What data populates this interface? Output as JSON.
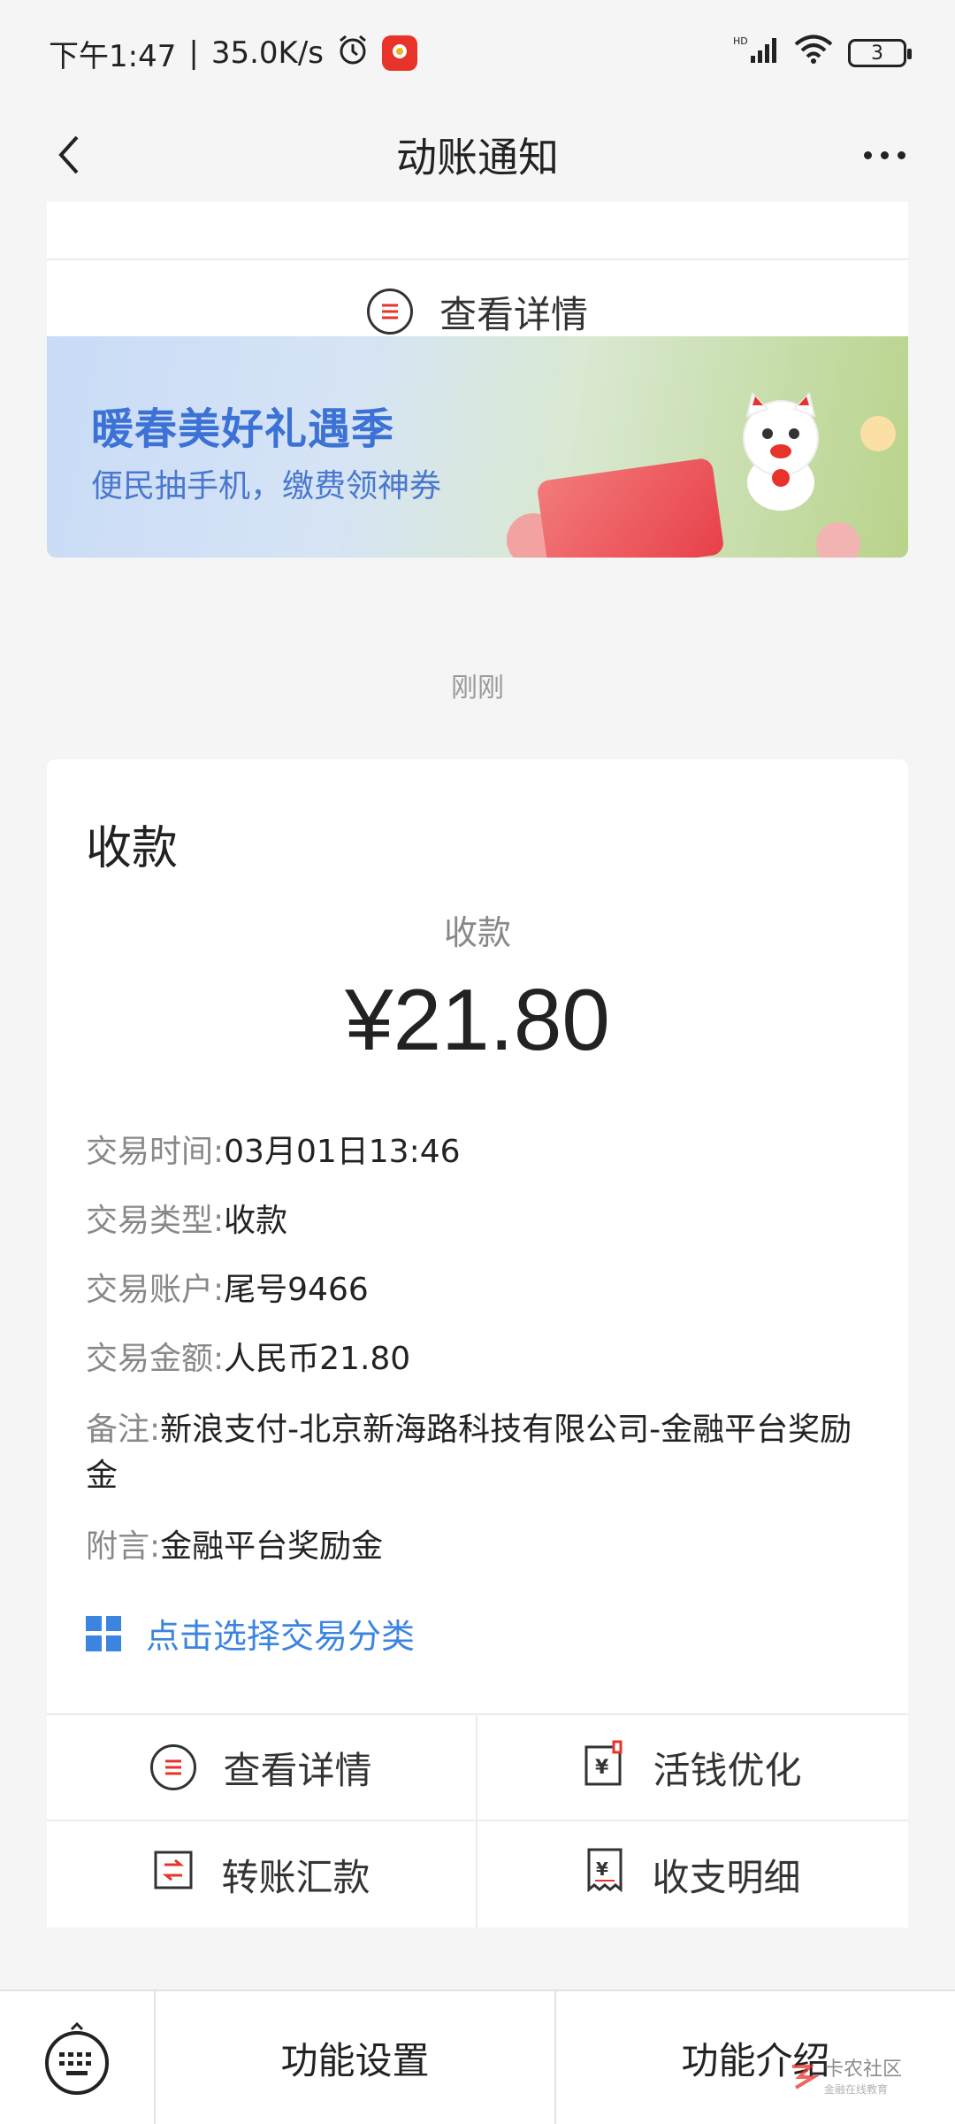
{
  "status_bar": {
    "time": "下午1:47",
    "net_speed": "35.0K/s",
    "battery": "3"
  },
  "navbar": {
    "title": "动账通知"
  },
  "prev_card": {
    "detail_label": "查看详情"
  },
  "banner": {
    "title": "暖春美好礼遇季",
    "subtitle": "便民抽手机，缴费领神券"
  },
  "timestamp": "刚刚",
  "message": {
    "title": "收款",
    "subtitle": "收款",
    "amount": "¥21.80",
    "rows": [
      {
        "label": "交易时间:",
        "value": "03月01日13:46"
      },
      {
        "label": "交易类型:",
        "value": "收款"
      },
      {
        "label": "交易账户:",
        "value": "尾号9466"
      },
      {
        "label": "交易金额:",
        "value": "人民币21.80"
      },
      {
        "label": "备注:",
        "value": "新浪支付-北京新海路科技有限公司-金融平台奖励金"
      },
      {
        "label": "附言:",
        "value": "金融平台奖励金"
      }
    ],
    "classify_label": "点击选择交易分类",
    "actions": [
      {
        "label": "查看详情",
        "icon": "list-icon"
      },
      {
        "label": "活钱优化",
        "icon": "yuan-doc-icon"
      },
      {
        "label": "转账汇款",
        "icon": "transfer-icon"
      },
      {
        "label": "收支明细",
        "icon": "receipt-icon"
      }
    ]
  },
  "bottom_bar": {
    "settings_label": "功能设置",
    "intro_label": "功能介绍"
  },
  "watermark": {
    "line1": "卡农社区",
    "line2": "金融在线教育"
  },
  "colors": {
    "accent_blue": "#3b84e0",
    "banner_title": "#3c71d6",
    "background": "#f5f5f5"
  }
}
